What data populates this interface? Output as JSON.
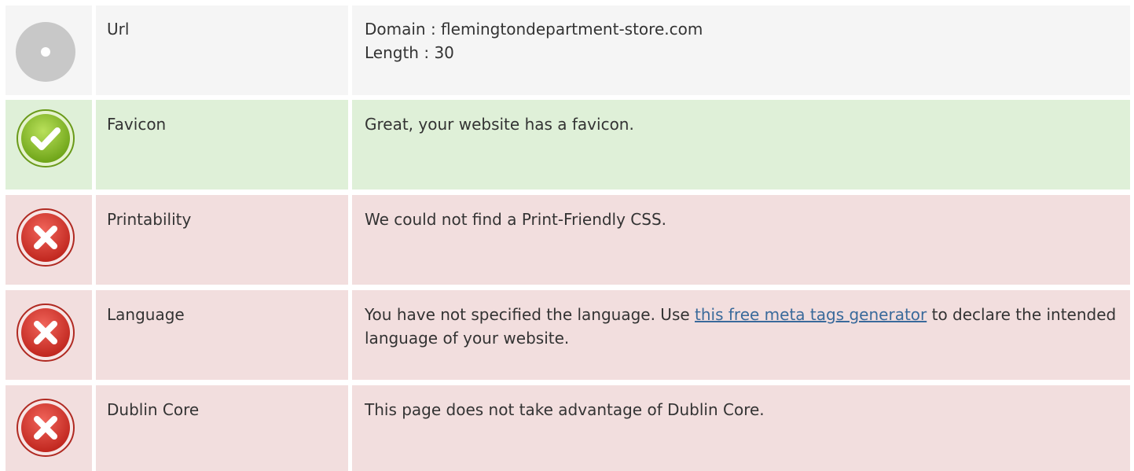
{
  "colors": {
    "neutral_bg": "#f5f5f5",
    "pass_bg": "#dff0d8",
    "fail_bg": "#f2dede",
    "link": "#3a6a9b"
  },
  "rows": [
    {
      "status": "neutral",
      "icon": "circle-neutral-icon",
      "name": "Url",
      "desc_line1": "Domain : flemingtondepartment-store.com",
      "desc_line2": "Length : 30"
    },
    {
      "status": "pass",
      "icon": "check-icon",
      "name": "Favicon",
      "desc": "Great, your website has a favicon."
    },
    {
      "status": "fail",
      "icon": "error-x-icon",
      "name": "Printability",
      "desc": "We could not find a Print-Friendly CSS."
    },
    {
      "status": "fail",
      "icon": "error-x-icon",
      "name": "Language",
      "desc_before": "You have not specified the language. Use ",
      "desc_link": "this free meta tags generator",
      "desc_after": " to declare the intended language of your website."
    },
    {
      "status": "fail",
      "icon": "error-x-icon",
      "name": "Dublin Core",
      "desc": "This page does not take advantage of Dublin Core."
    }
  ]
}
